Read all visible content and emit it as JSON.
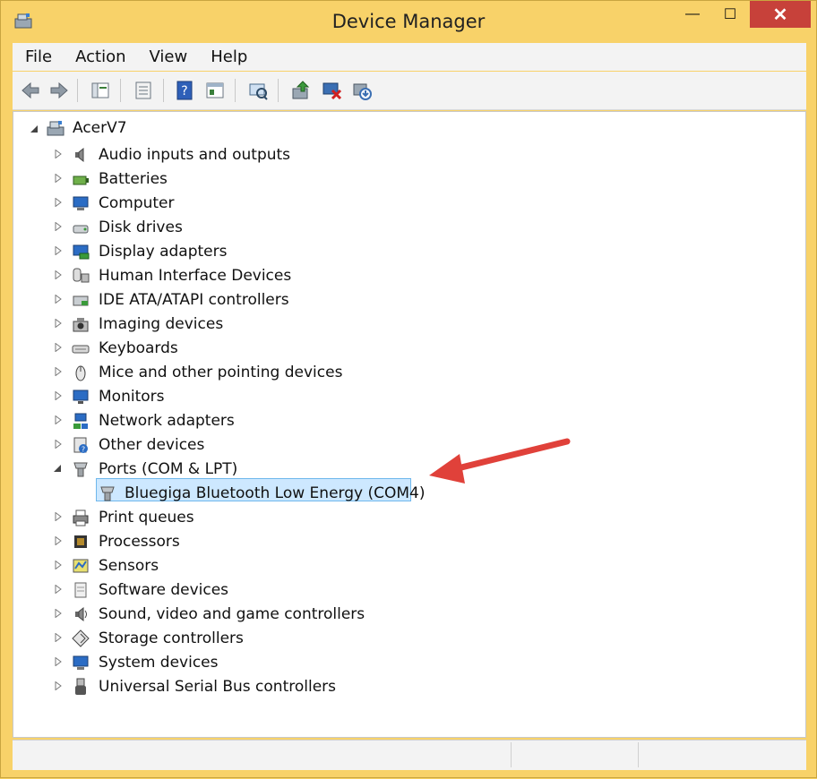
{
  "window": {
    "title": "Device Manager",
    "min_glyph": "—",
    "max_glyph": "☐",
    "close_glyph": "✕"
  },
  "menu": [
    "File",
    "Action",
    "View",
    "Help"
  ],
  "toolbar_icons": [
    "back-icon",
    "forward-icon",
    "show-hide-tree-icon",
    "properties-icon",
    "help-icon",
    "view-icon",
    "scan-hardware-icon",
    "update-driver-icon",
    "uninstall-icon",
    "disable-icon"
  ],
  "tree": {
    "root": "AcerV7",
    "categories": [
      {
        "label": "Audio inputs and outputs",
        "icon": "speaker-icon"
      },
      {
        "label": "Batteries",
        "icon": "battery-icon"
      },
      {
        "label": "Computer",
        "icon": "computer-icon"
      },
      {
        "label": "Disk drives",
        "icon": "disk-drive-icon"
      },
      {
        "label": "Display adapters",
        "icon": "display-adapter-icon"
      },
      {
        "label": "Human Interface Devices",
        "icon": "hid-icon"
      },
      {
        "label": "IDE ATA/ATAPI controllers",
        "icon": "ide-controller-icon"
      },
      {
        "label": "Imaging devices",
        "icon": "camera-icon"
      },
      {
        "label": "Keyboards",
        "icon": "keyboard-icon"
      },
      {
        "label": "Mice and other pointing devices",
        "icon": "mouse-icon"
      },
      {
        "label": "Monitors",
        "icon": "monitor-icon"
      },
      {
        "label": "Network adapters",
        "icon": "network-icon"
      },
      {
        "label": "Other devices",
        "icon": "unknown-device-icon"
      },
      {
        "label": "Ports (COM & LPT)",
        "icon": "port-icon",
        "expanded": true
      },
      {
        "label": "Bluegiga Bluetooth Low Energy (COM4)",
        "icon": "port-icon",
        "child": true,
        "selected": true
      },
      {
        "label": "Print queues",
        "icon": "printer-icon"
      },
      {
        "label": "Processors",
        "icon": "processor-icon"
      },
      {
        "label": "Sensors",
        "icon": "sensor-icon"
      },
      {
        "label": "Software devices",
        "icon": "software-device-icon"
      },
      {
        "label": "Sound, video and game controllers",
        "icon": "sound-icon"
      },
      {
        "label": "Storage controllers",
        "icon": "storage-icon"
      },
      {
        "label": "System devices",
        "icon": "system-device-icon"
      },
      {
        "label": "Universal Serial Bus controllers",
        "icon": "usb-icon"
      }
    ]
  },
  "colors": {
    "title_bar": "#f8d269",
    "selection": "#cde8ff",
    "arrow": "#e0413a",
    "close": "#c7413a"
  }
}
